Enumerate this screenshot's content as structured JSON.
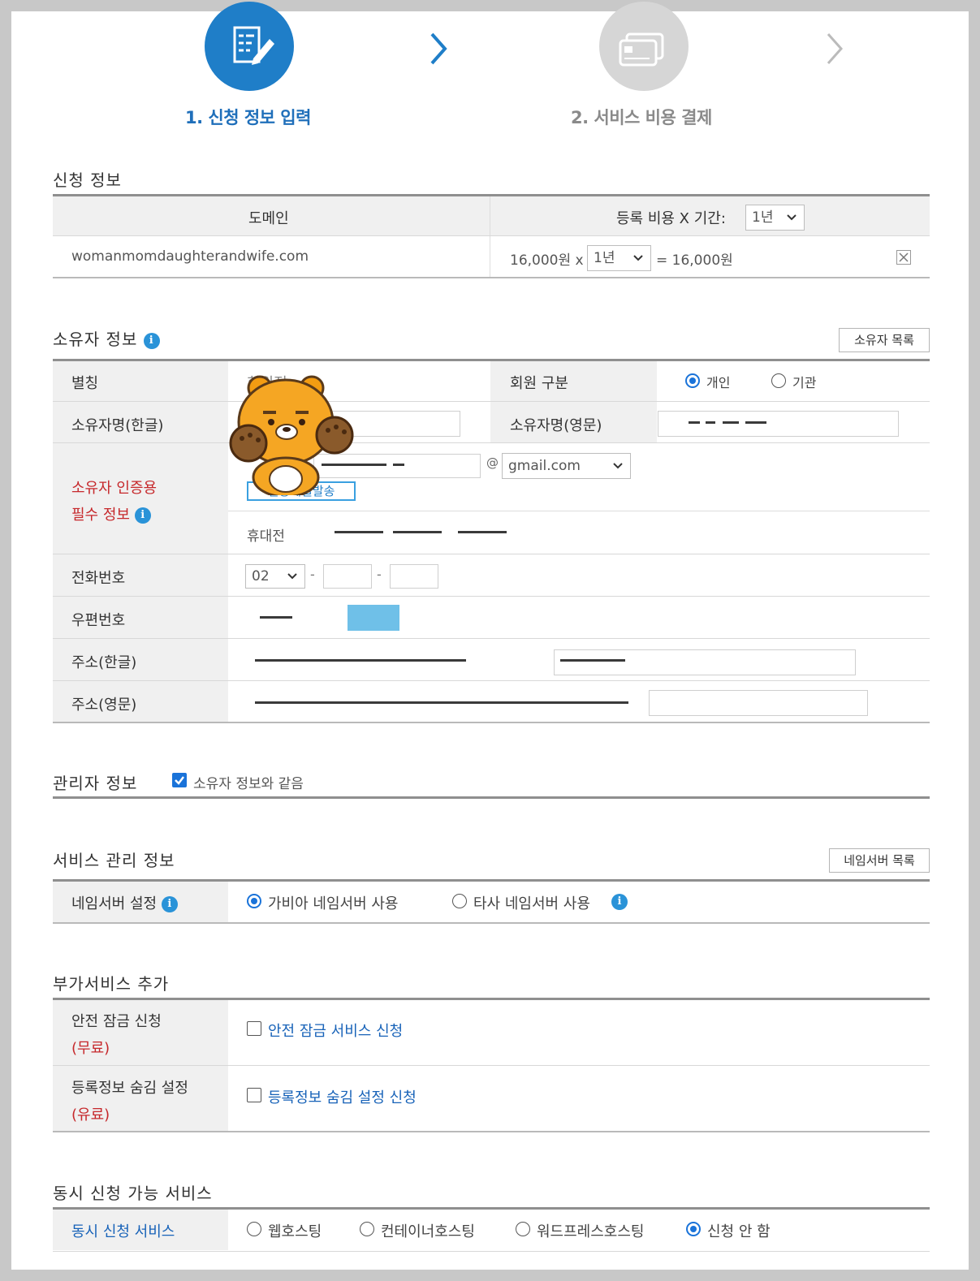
{
  "steps": [
    {
      "label": "1. 신청 정보 입력",
      "icon": "form-edit-icon",
      "active": true
    },
    {
      "label": "2. 서비스 비용 결제",
      "icon": "credit-card-icon",
      "active": false
    }
  ],
  "application": {
    "title": "신청 정보",
    "col_domain": "도메인",
    "col_fee": "등록 비용 X 기간:",
    "period_header_value": "1년",
    "row": {
      "domain": "womanmomdaughterandwife.com",
      "price": "16,000원 x",
      "period": "1년",
      "total": "= 16,000원"
    }
  },
  "owner": {
    "title": "소유자 정보",
    "list_button": "소유자 목록",
    "labels": {
      "nickname": "별칭",
      "member_type": "회원 구분",
      "name_kr": "소유자명(한글)",
      "name_en": "소유자명(영문)",
      "auth_line1": "소유자 인증용",
      "auth_line2": "필수 정보",
      "phone": "전화번호",
      "zip": "우편번호",
      "addr_kr": "주소(한글)",
      "addr_en": "주소(영문)"
    },
    "nickname_value": "회원정",
    "member_types": [
      "개인",
      "기관"
    ],
    "email_domain": "gmail.com",
    "email_at": "@",
    "send_mail_button": "인증메일발송",
    "mobile_label": "휴대전",
    "phone_prefix": "02",
    "dash": "-"
  },
  "admin": {
    "title": "관리자 정보",
    "same_as_owner": "소유자 정보와 같음"
  },
  "service": {
    "title": "서비스 관리 정보",
    "list_button": "네임서버 목록",
    "ns_label": "네임서버 설정",
    "ns_options": [
      "가비아 네임서버 사용",
      "타사 네임서버 사용"
    ]
  },
  "addon": {
    "title": "부가서비스 추가",
    "rows": [
      {
        "label": "안전 잠금 신청",
        "note": "(무료)",
        "option": "안전 잠금 서비스 신청"
      },
      {
        "label": "등록정보 숨김 설정",
        "note": "(유료)",
        "option": "등록정보 숨김 설정 신청"
      }
    ]
  },
  "concurrent": {
    "title": "동시 신청 가능 서비스",
    "label": "동시 신청 서비스",
    "options": [
      "웹호스팅",
      "컨테이너호스팅",
      "워드프레스호스팅",
      "신청 안 함"
    ]
  },
  "colors": {
    "accent": "#1f7ec8",
    "required": "#c6282b",
    "link": "#1762b8"
  }
}
